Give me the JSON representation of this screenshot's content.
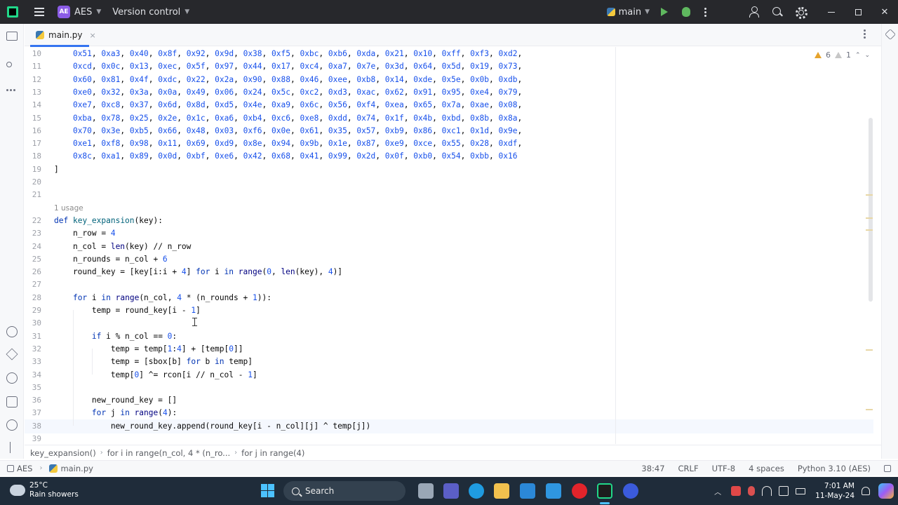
{
  "titlebar": {
    "project_badge": "AE",
    "project_name": "AES",
    "vcs_label": "Version control",
    "branch": "main"
  },
  "tab": {
    "label": "main.py",
    "close": "×"
  },
  "inspections": {
    "warnings": "6",
    "weak_warnings": "1"
  },
  "editor": {
    "usage_hint": "1 usage",
    "lines": [
      {
        "n": "10",
        "text": "    0x51, 0xa3, 0x40, 0x8f, 0x92, 0x9d, 0x38, 0xf5, 0xbc, 0xb6, 0xda, 0x21, 0x10, 0xff, 0xf3, 0xd2,"
      },
      {
        "n": "11",
        "text": "    0xcd, 0x0c, 0x13, 0xec, 0x5f, 0x97, 0x44, 0x17, 0xc4, 0xa7, 0x7e, 0x3d, 0x64, 0x5d, 0x19, 0x73,"
      },
      {
        "n": "12",
        "text": "    0x60, 0x81, 0x4f, 0xdc, 0x22, 0x2a, 0x90, 0x88, 0x46, 0xee, 0xb8, 0x14, 0xde, 0x5e, 0x0b, 0xdb,"
      },
      {
        "n": "13",
        "text": "    0xe0, 0x32, 0x3a, 0x0a, 0x49, 0x06, 0x24, 0x5c, 0xc2, 0xd3, 0xac, 0x62, 0x91, 0x95, 0xe4, 0x79,"
      },
      {
        "n": "14",
        "text": "    0xe7, 0xc8, 0x37, 0x6d, 0x8d, 0xd5, 0x4e, 0xa9, 0x6c, 0x56, 0xf4, 0xea, 0x65, 0x7a, 0xae, 0x08,"
      },
      {
        "n": "15",
        "text": "    0xba, 0x78, 0x25, 0x2e, 0x1c, 0xa6, 0xb4, 0xc6, 0xe8, 0xdd, 0x74, 0x1f, 0x4b, 0xbd, 0x8b, 0x8a,"
      },
      {
        "n": "16",
        "text": "    0x70, 0x3e, 0xb5, 0x66, 0x48, 0x03, 0xf6, 0x0e, 0x61, 0x35, 0x57, 0xb9, 0x86, 0xc1, 0x1d, 0x9e,"
      },
      {
        "n": "17",
        "text": "    0xe1, 0xf8, 0x98, 0x11, 0x69, 0xd9, 0x8e, 0x94, 0x9b, 0x1e, 0x87, 0xe9, 0xce, 0x55, 0x28, 0xdf,"
      },
      {
        "n": "18",
        "text": "    0x8c, 0xa1, 0x89, 0x0d, 0xbf, 0xe6, 0x42, 0x68, 0x41, 0x99, 0x2d, 0x0f, 0xb0, 0x54, 0xbb, 0x16"
      },
      {
        "n": "19",
        "text": "]"
      },
      {
        "n": "20",
        "text": ""
      },
      {
        "n": "21",
        "text": ""
      },
      {
        "n": "22",
        "text": "def key_expansion(key):"
      },
      {
        "n": "23",
        "text": "    n_row = 4"
      },
      {
        "n": "24",
        "text": "    n_col = len(key) // n_row"
      },
      {
        "n": "25",
        "text": "    n_rounds = n_col + 6"
      },
      {
        "n": "26",
        "text": "    round_key = [key[i:i + 4] for i in range(0, len(key), 4)]"
      },
      {
        "n": "27",
        "text": ""
      },
      {
        "n": "28",
        "text": "    for i in range(n_col, 4 * (n_rounds + 1)):"
      },
      {
        "n": "29",
        "text": "        temp = round_key[i - 1]"
      },
      {
        "n": "30",
        "text": ""
      },
      {
        "n": "31",
        "text": "        if i % n_col == 0:"
      },
      {
        "n": "32",
        "text": "            temp = temp[1:4] + [temp[0]]"
      },
      {
        "n": "33",
        "text": "            temp = [sbox[b] for b in temp]"
      },
      {
        "n": "34",
        "text": "            temp[0] ^= rcon[i // n_col - 1]"
      },
      {
        "n": "35",
        "text": ""
      },
      {
        "n": "36",
        "text": "        new_round_key = []"
      },
      {
        "n": "37",
        "text": "        for j in range(4):"
      },
      {
        "n": "38",
        "text": "            new_round_key.append(round_key[i - n_col][j] ^ temp[j])"
      },
      {
        "n": "39",
        "text": ""
      }
    ]
  },
  "breadcrumbs": [
    "key_expansion()",
    "for i in range(n_col, 4 * (n_ro...",
    "for j in range(4)"
  ],
  "statusbar": {
    "project": "AES",
    "file": "main.py",
    "position": "38:47",
    "line_sep": "CRLF",
    "encoding": "UTF-8",
    "indent": "4 spaces",
    "interpreter": "Python 3.10 (AES)"
  },
  "taskbar": {
    "temp": "25°C",
    "weather": "Rain showers",
    "search": "Search",
    "time": "7:01 AM",
    "date": "11-May-24"
  }
}
